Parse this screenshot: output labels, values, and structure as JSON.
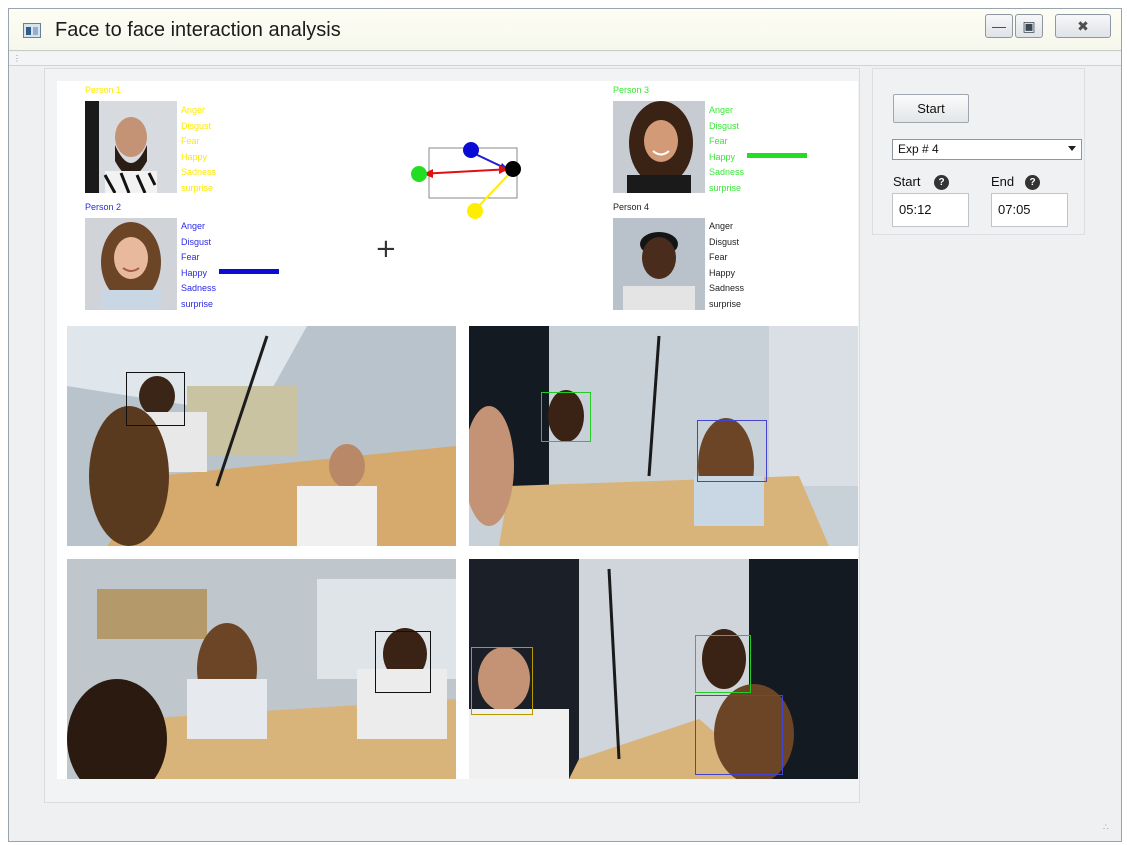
{
  "window": {
    "title": "Face to face interaction analysis",
    "minimize_icon": "minimize-icon",
    "maximize_icon": "maximize-icon",
    "close_icon": "close-icon"
  },
  "persons": [
    {
      "label": "Person 1",
      "color": "#ffea00",
      "emotions": [
        "Anger",
        "Disgust",
        "Fear",
        "Happy",
        "Sadness",
        "surprise"
      ],
      "active_emotion": null,
      "level": 0
    },
    {
      "label": "Person 2",
      "color": "#2a2ae6",
      "emotions": [
        "Anger",
        "Disgust",
        "Fear",
        "Happy",
        "Sadness",
        "surprise"
      ],
      "active_emotion": "Happy",
      "level": 0.6
    },
    {
      "label": "Person 3",
      "color": "#39e639",
      "emotions": [
        "Anger",
        "Disgust",
        "Fear",
        "Happy",
        "Sadness",
        "surprise"
      ],
      "active_emotion": "Happy",
      "level": 0.6
    },
    {
      "label": "Person 4",
      "color": "#222222",
      "emotions": [
        "Anger",
        "Disgust",
        "Fear",
        "Happy",
        "Sadness",
        "surprise"
      ],
      "active_emotion": null,
      "level": 0
    }
  ],
  "graph": {
    "node_colors": [
      "#0b0bd6",
      "#22dd22",
      "#000000",
      "#ffee00"
    ],
    "arrow_color_red": "#e01010",
    "arrow_color_blue": "#1e1ed0"
  },
  "controls": {
    "start_button": "Start",
    "experiment_select": "Exp # 4",
    "start_label": "Start",
    "end_label": "End",
    "help_glyph": "?",
    "start_time": "05:12",
    "end_time": "07:05"
  }
}
